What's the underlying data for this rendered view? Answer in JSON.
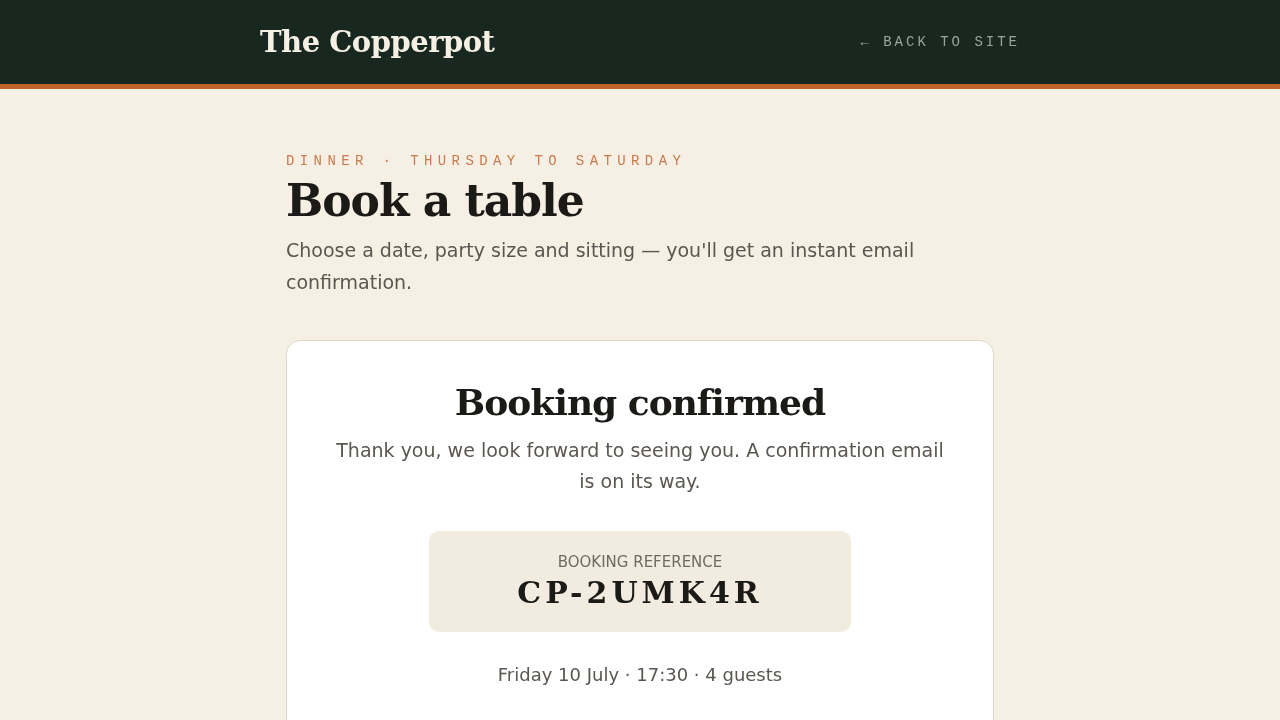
{
  "header": {
    "brand": "The Copperpot",
    "back_link": "← BACK TO SITE"
  },
  "intro": {
    "eyebrow": "DINNER · THURSDAY TO SATURDAY",
    "title": "Book a table",
    "lead": "Choose a date, party size and sitting — you'll get an instant email confirmation."
  },
  "confirmation": {
    "title": "Booking confirmed",
    "message": "Thank you, we look forward to seeing you. A confirmation email is on its way.",
    "reference_label": "BOOKING REFERENCE",
    "reference": "CP-2UMK4R",
    "summary": "Friday 10 July · 17:30 · 4 guests"
  }
}
